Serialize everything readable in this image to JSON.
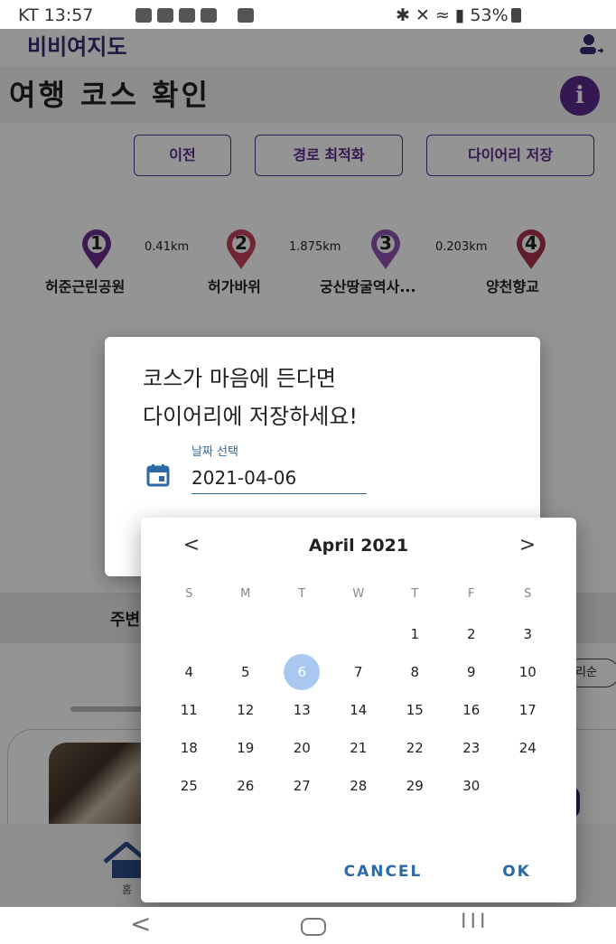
{
  "status_bar": {
    "carrier_time": "KT 13:57",
    "battery_text": "53%"
  },
  "app": {
    "logo_text": "비비여지도",
    "page_title": "여행 코스 확인",
    "info_label": "i",
    "buttons": {
      "prev": "이전",
      "optimize": "경로 최적화",
      "save_diary": "다이어리 저장"
    },
    "route": {
      "stops": [
        {
          "num": "1",
          "name": "허준근린공원",
          "color": "#6b2d8f"
        },
        {
          "num": "2",
          "name": "허가바위",
          "color": "#c2425a"
        },
        {
          "num": "3",
          "name": "궁산땅굴역사...",
          "color": "#8d54b0"
        },
        {
          "num": "4",
          "name": "양천향교",
          "color": "#a8324a"
        }
      ],
      "distances": [
        "0.41km",
        "1.875km",
        "0.203km"
      ]
    },
    "nearby_title": "주변",
    "sort_label": "리순",
    "home_label": "홈"
  },
  "dialog": {
    "line1": "코스가 마음에 든다면",
    "line2": "다이어리에 저장하세요!",
    "date_label": "날짜 선택",
    "date_value": "2021-04-06"
  },
  "picker": {
    "month_title": "April 2021",
    "prev_label": "<",
    "next_label": ">",
    "weekdays": [
      "S",
      "M",
      "T",
      "W",
      "T",
      "F",
      "S"
    ],
    "first_weekday": 4,
    "days_in_month": 30,
    "selected_day": 6,
    "cancel_label": "CANCEL",
    "ok_label": "OK",
    "selected_color": "#a8c8f2"
  },
  "system_nav": {
    "back": "<",
    "recent": "III"
  }
}
